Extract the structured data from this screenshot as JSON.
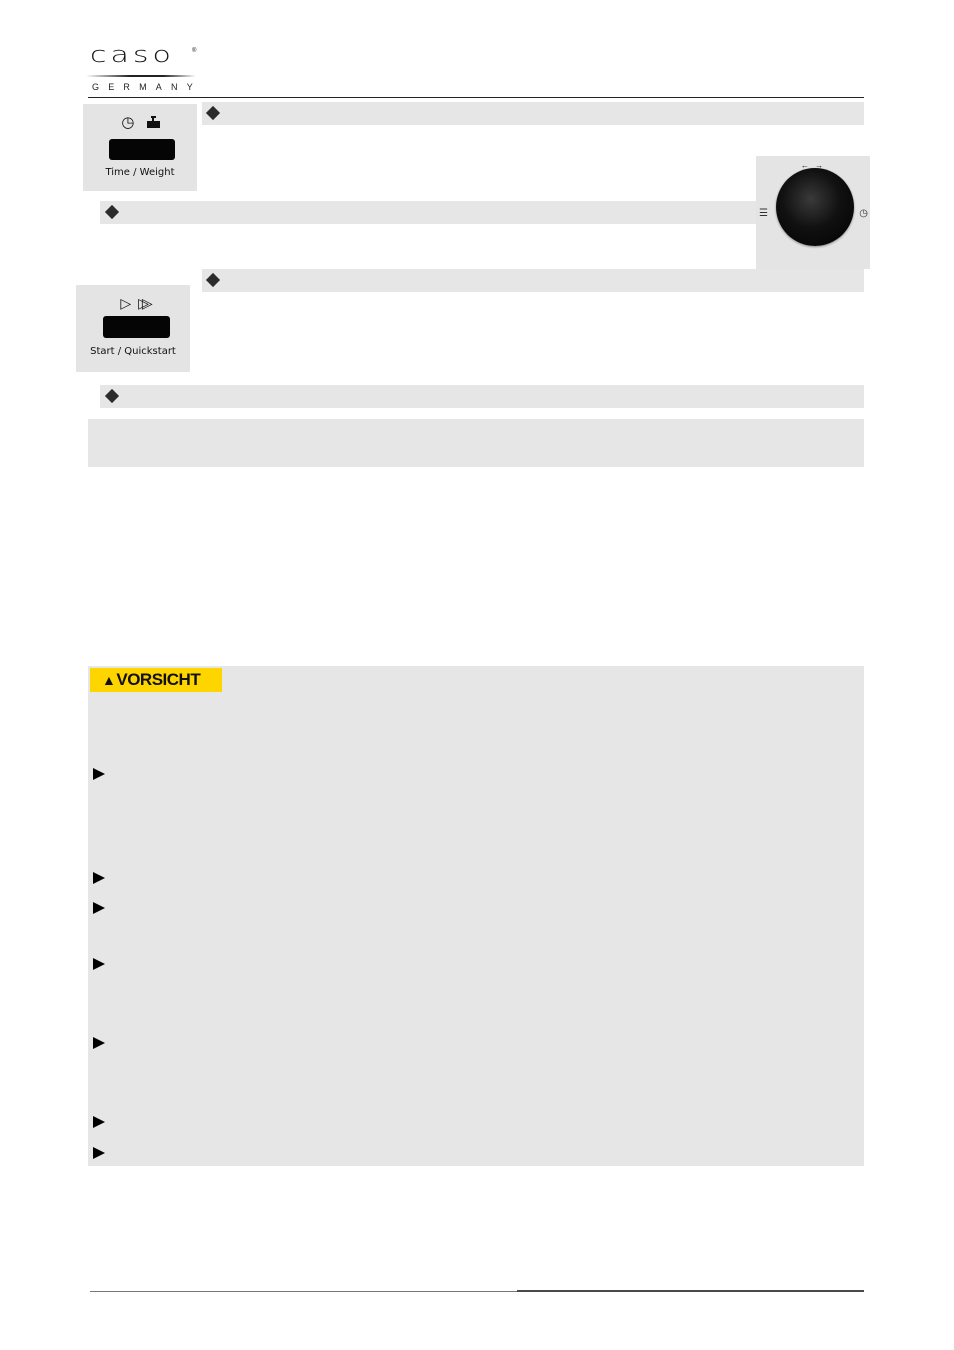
{
  "header": {
    "brand_name": "caso",
    "brand_registered": "®",
    "brand_subtitle": "GERMANY"
  },
  "controls": {
    "time_weight_button": {
      "label": "Time / Weight",
      "icons": [
        "clock-icon",
        "weight-icon"
      ],
      "clock_glyph": "◷",
      "weight_glyph": "⏏"
    },
    "start_button": {
      "label": "Start / Quickstart",
      "icons": [
        "play-icon",
        "fast-forward-icon"
      ],
      "play_glyph": "▷",
      "fast_glyph": "⊳⊳"
    },
    "rotary_knob": {
      "left_icon": "menu-list-icon",
      "left_glyph": "☰",
      "right_icon": "clock-icon",
      "right_glyph": "◷",
      "top_glyph": "← →"
    }
  },
  "sections": {
    "bullet_marker": "diamond",
    "bullet_bars": 4
  },
  "caution": {
    "label": "VORSICHT",
    "warning_glyph": "▲",
    "label_color": "#ffd500",
    "bullet_count": 7
  },
  "colors": {
    "panel_gray": "#e6e6e6",
    "caution_yellow": "#ffd500"
  }
}
